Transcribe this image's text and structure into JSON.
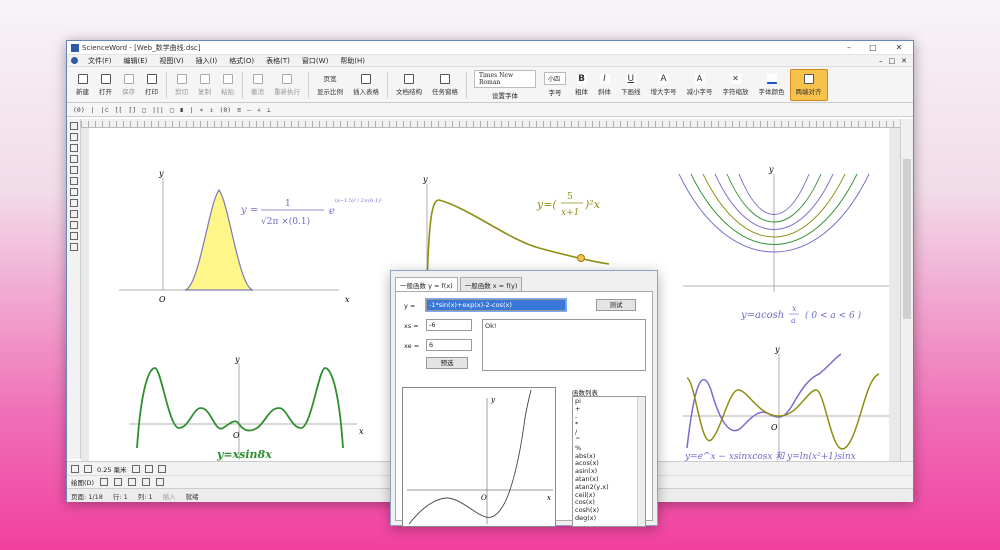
{
  "window": {
    "title": "ScienceWord - [Web_数学曲线.dsc]",
    "controls": [
      "–",
      "□",
      "✕"
    ]
  },
  "menu": {
    "items": [
      "文件(F)",
      "编辑(E)",
      "视图(V)",
      "插入(I)",
      "格式(O)",
      "表格(T)",
      "窗口(W)",
      "帮助(H)"
    ],
    "right": [
      "–",
      "□",
      "✕"
    ]
  },
  "toolbar": {
    "new": "新建",
    "open": "打开",
    "save": "保存",
    "print": "打印",
    "cut": "剪切",
    "copy": "复制",
    "paste": "粘贴",
    "undo": "撤消",
    "redo": "重新执行",
    "page_label": "页宽",
    "zoom": "显示比例",
    "insert_table": "插入表格",
    "doc_structure": "文档结构",
    "task_table": "任务窗格",
    "font_name": "Times New Roman",
    "font_setting": "设置字体",
    "font_size": "小四",
    "font_size_label": "字号",
    "bold": "粗体",
    "italic": "斜体",
    "underline": "下画线",
    "increase_font": "增大字号",
    "decrease_font": "减小字号",
    "char_scale": "字符缩放",
    "font_color": "字体颜色",
    "align_both": "两端对齐"
  },
  "toolbar2": {
    "items": [
      "(0)",
      "|",
      "|⊂",
      "[[",
      "[]",
      "□",
      "|||",
      "□",
      "∎",
      "|",
      "∗",
      "⇕",
      "(0)",
      "≡",
      "—",
      "∠",
      "⊥"
    ]
  },
  "bottom_toolbar": {
    "line_width": "0.25 毫米",
    "draw_label": "绘图(D)"
  },
  "status": {
    "page": "页面: 1/18",
    "row": "行: 1",
    "col": "列: 1",
    "mode": "插入",
    "edit_mode": "就绪"
  },
  "graphs": {
    "g1": {
      "formula_lhs": "y =",
      "formula_num": "1",
      "formula_den": "√2π ×(0.1)",
      "formula_exp": "(x−1.5)² / 2×(0.1)²",
      "x_label": "x",
      "y_label": "y",
      "origin": "O"
    },
    "g2": {
      "formula_lhs": "y=(",
      "formula_num": "5",
      "formula_den": "x+1",
      "formula_rhs": ")²x",
      "x_label": "x",
      "y_label": "y",
      "origin": "O"
    },
    "g3": {
      "formula": "y=acosh",
      "frac_num": "x",
      "frac_den": "a",
      "cond": "( 0 < a < 6 )",
      "x_label": "x",
      "y_label": "y"
    },
    "g4": {
      "formula": "y=xsin8x",
      "x_label": "x",
      "y_label": "y",
      "origin": "O"
    },
    "g5": {
      "formula": "y=e^x − xsinxcosx 和 y=ln(x²+1)sinx",
      "x_label": "x",
      "y_label": "y",
      "origin": "O"
    }
  },
  "dialog": {
    "tab1": "一般函数 y = f(x)",
    "tab2": "一般函数 x = f(y)",
    "y_label": "y =",
    "y_value": "-1*sin(x)+exp(x)-2-cos(x)",
    "xs_label": "xs =",
    "xs_value": "-6",
    "xe_label": "xe =",
    "xe_value": "6",
    "test_button": "测试",
    "preview_button": "预选",
    "output": "Ok!",
    "func_list_label": "函数列表",
    "func_list": [
      "pi",
      "+",
      "-",
      "*",
      "/",
      "^",
      "%",
      "abs(x)",
      "acos(x)",
      "asin(x)",
      "atan(x)",
      "atan2(y,x)",
      "ceil(x)",
      "cos(x)",
      "cosh(x)",
      "deg(x)"
    ],
    "plot_labels": {
      "x": "x",
      "y": "y",
      "origin": "O"
    }
  },
  "colors": {
    "yellow_fill": "#fff68a",
    "olive": "#8e8e12",
    "green": "#2f8f2f",
    "purple": "#7c6ccd",
    "formula_blue": "#6c6cc8",
    "accent": "#f6c24c"
  }
}
